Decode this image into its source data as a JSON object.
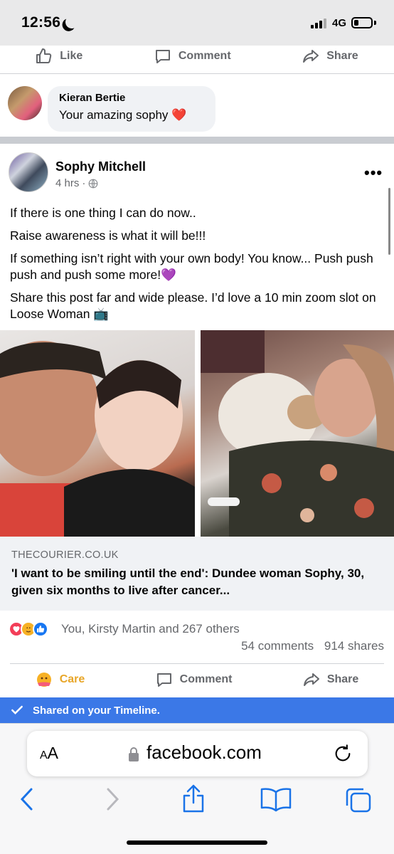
{
  "status_bar": {
    "time": "12:56",
    "network": "4G",
    "battery_level": 0.25
  },
  "top_actions": {
    "like": "Like",
    "comment": "Comment",
    "share": "Share"
  },
  "comment": {
    "author": "Kieran Bertie",
    "text": "Your amazing sophy",
    "emoji": "❤️"
  },
  "post": {
    "author": "Sophy Mitchell",
    "time": "4 hrs",
    "separator": "·",
    "more": "•••",
    "paragraphs": [
      "If there is one thing I can do now..",
      "Raise awareness is what it will be!!!",
      "If something isn’t right with your own body! You know... Push push push and push some more!💜",
      "Share this post far and wide please. I’d love a 10 min zoom slot on Loose Woman 📺"
    ],
    "link": {
      "domain": "THECOURIER.CO.UK",
      "title": "'I want to be smiling until the end': Dundee woman Sophy, 30, given six months to live after cancer..."
    },
    "reactions_text": "You, Kirsty Martin and 267 others",
    "comments_count": "54 comments",
    "shares_count": "914 shares"
  },
  "bottom_actions": {
    "care": "Care",
    "comment": "Comment",
    "share": "Share"
  },
  "shared_banner": "Shared on your Timeline.",
  "safari": {
    "aa_small": "A",
    "aa_large": "A",
    "url": "facebook.com"
  },
  "colors": {
    "brand_blue": "#3b78e7",
    "care_yellow": "#e8a628",
    "muted": "#65676b"
  }
}
